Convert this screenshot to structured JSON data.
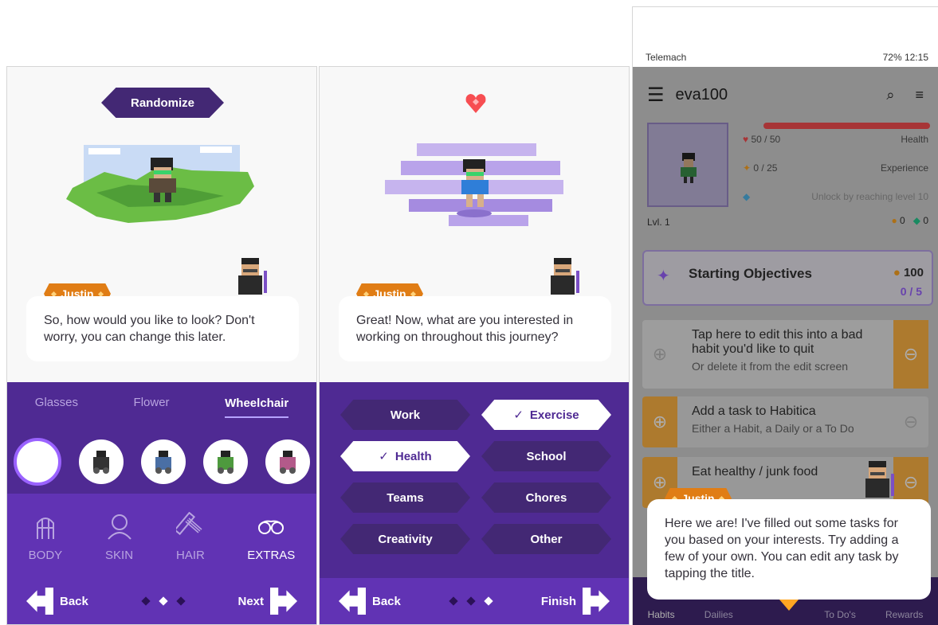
{
  "panel1": {
    "randomize_label": "Randomize",
    "speaker": "Justin",
    "dialog": "So, how would you like to look? Don't worry, you can change this later.",
    "category_tabs": [
      {
        "label": "Glasses",
        "active": false
      },
      {
        "label": "Flower",
        "active": false
      },
      {
        "label": "Wheelchair",
        "active": true
      }
    ],
    "section_tabs": [
      {
        "label": "BODY",
        "icon": "body-icon",
        "active": false
      },
      {
        "label": "SKIN",
        "icon": "skin-icon",
        "active": false
      },
      {
        "label": "HAIR",
        "icon": "hair-comb-icon",
        "active": false
      },
      {
        "label": "EXTRAS",
        "icon": "glasses-icon",
        "active": true
      }
    ],
    "back_label": "Back",
    "next_label": "Next"
  },
  "panel2": {
    "speaker": "Justin",
    "dialog": "Great! Now, what are you interested in working on throughout this journey?",
    "interests": [
      {
        "label": "Work",
        "selected": false
      },
      {
        "label": "Exercise",
        "selected": true
      },
      {
        "label": "Health",
        "selected": true
      },
      {
        "label": "School",
        "selected": false
      },
      {
        "label": "Teams",
        "selected": false
      },
      {
        "label": "Chores",
        "selected": false
      },
      {
        "label": "Creativity",
        "selected": false
      },
      {
        "label": "Other",
        "selected": false
      }
    ],
    "back_label": "Back",
    "finish_label": "Finish"
  },
  "panel3": {
    "status_left": "Telemach",
    "status_right": "72% 12:15",
    "username": "eva100",
    "health": "50 / 50",
    "health_label": "Health",
    "experience": "0 / 25",
    "experience_label": "Experience",
    "mana_label": "Unlock by reaching level 10",
    "level": "Lvl. 1",
    "gold": "0",
    "gems": "0",
    "objectives_title": "Starting Objectives",
    "objectives_reward": "100",
    "objectives_progress": "0 / 5",
    "tasks": [
      {
        "title": "Tap here to edit this into a bad habit you'd like to quit",
        "sub": "Or delete it from the edit screen"
      },
      {
        "title": "Add a task to Habitica",
        "sub": "Either a Habit, a Daily or a To Do"
      },
      {
        "title": "Eat healthy / junk food",
        "sub": ""
      }
    ],
    "speaker": "Justin",
    "dialog": "Here we are! I've filled out some tasks for you based on your interests. Try adding a few of your own. You can edit any task by tapping the title.",
    "nav": [
      "Habits",
      "Dailies",
      "To Do's",
      "Rewards"
    ]
  }
}
